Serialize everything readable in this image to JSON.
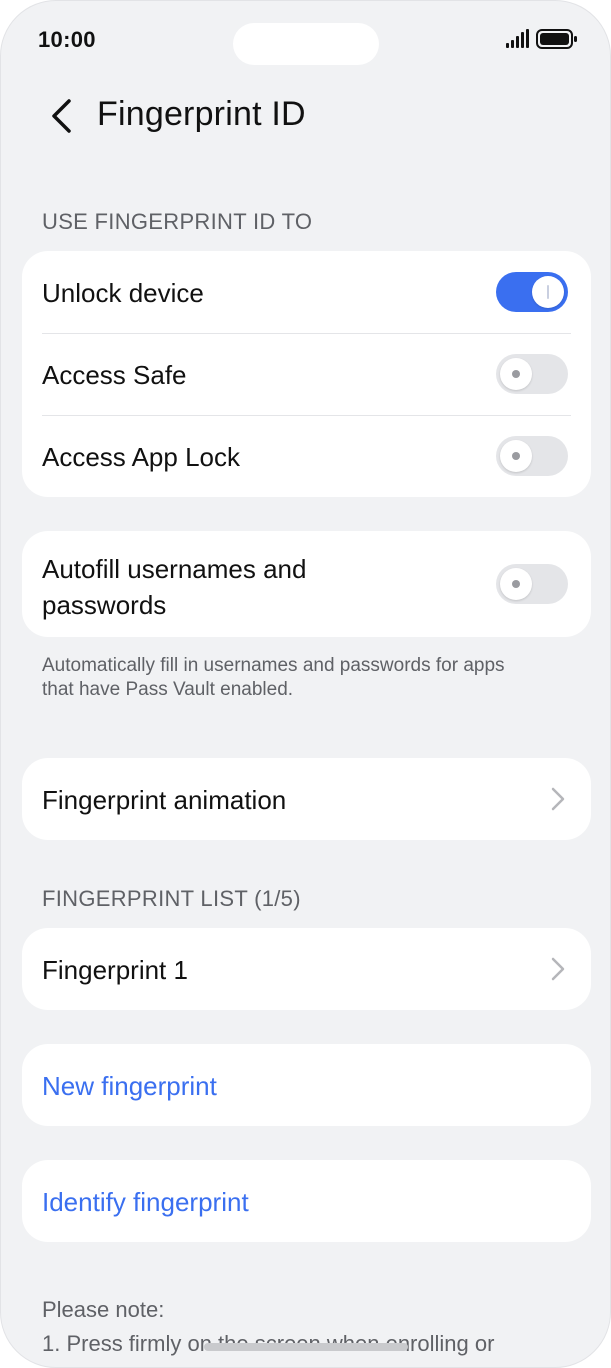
{
  "status_bar": {
    "time": "10:00"
  },
  "header": {
    "title": "Fingerprint ID"
  },
  "sections": {
    "use_for": "USE FINGERPRINT ID TO",
    "list": "FINGERPRINT LIST (1/5)"
  },
  "use_for_items": [
    {
      "label": "Unlock device",
      "enabled": true
    },
    {
      "label": "Access Safe",
      "enabled": false
    },
    {
      "label": "Access App Lock",
      "enabled": false
    }
  ],
  "autofill": {
    "label_line1": "Autofill usernames and",
    "label_line2": "passwords",
    "enabled": false,
    "description_line1": "Automatically fill in usernames and passwords for apps",
    "description_line2": "that have Pass Vault enabled."
  },
  "animation": {
    "label": "Fingerprint animation"
  },
  "fingerprints": [
    {
      "label": "Fingerprint 1"
    }
  ],
  "actions": {
    "new_fingerprint": "New fingerprint",
    "identify_fingerprint": "Identify fingerprint"
  },
  "note": {
    "heading": "Please note:",
    "item1": "1. Press firmly on the screen when enrolling or"
  },
  "colors": {
    "accent": "#3a6ff0",
    "background": "#f1f2f4",
    "card": "#ffffff",
    "toggle_off": "#e4e5e8"
  }
}
